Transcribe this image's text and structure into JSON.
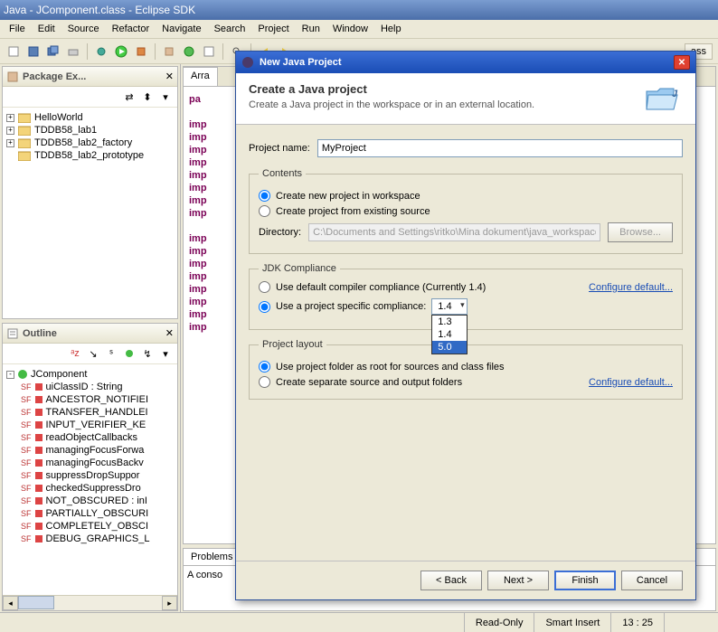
{
  "window": {
    "title": "Java - JComponent.class - Eclipse SDK"
  },
  "menu": [
    "File",
    "Edit",
    "Source",
    "Refactor",
    "Navigate",
    "Search",
    "Project",
    "Run",
    "Window",
    "Help"
  ],
  "package_explorer": {
    "title": "Package Ex...",
    "items": [
      {
        "label": "HelloWorld",
        "expandable": true
      },
      {
        "label": "TDDB58_lab1",
        "expandable": true
      },
      {
        "label": "TDDB58_lab2_factory",
        "expandable": true
      },
      {
        "label": "TDDB58_lab2_prototype",
        "expandable": false
      }
    ]
  },
  "outline": {
    "title": "Outline",
    "root": "JComponent",
    "items": [
      "uiClassID : String",
      "ANCESTOR_NOTIFIEI",
      "TRANSFER_HANDLEI",
      "INPUT_VERIFIER_KE",
      "readObjectCallbacks",
      "managingFocusForwa",
      "managingFocusBackv",
      "suppressDropSuppor",
      "checkedSuppressDro",
      "NOT_OBSCURED : inI",
      "PARTIALLY_OBSCURI",
      "COMPLETELY_OBSCI",
      "DEBUG_GRAPHICS_L"
    ]
  },
  "editor": {
    "tab": "Arra",
    "lines": [
      "pa",
      "",
      "imp",
      "imp",
      "imp",
      "imp",
      "imp",
      "imp",
      "imp",
      "imp",
      "",
      "imp",
      "imp",
      "imp",
      "imp",
      "imp",
      "imp",
      "imp",
      "imp"
    ]
  },
  "problems": {
    "tab": "Problems",
    "content": "A conso"
  },
  "dialog": {
    "title": "New Java Project",
    "banner_title": "Create a Java project",
    "banner_desc": "Create a Java project in the workspace or in an external location.",
    "project_name_label": "Project name:",
    "project_name_value": "MyProject",
    "contents": {
      "legend": "Contents",
      "opt1": "Create new project in workspace",
      "opt2": "Create project from existing source",
      "dir_label": "Directory:",
      "dir_value": "C:\\Documents and Settings\\ritko\\Mina dokument\\java_workspace",
      "browse": "Browse..."
    },
    "jdk": {
      "legend": "JDK Compliance",
      "opt1": "Use default compiler compliance (Currently 1.4)",
      "opt2": "Use a project specific compliance:",
      "selected": "1.4",
      "options": [
        "1.3",
        "1.4",
        "5.0"
      ],
      "configure": "Configure default..."
    },
    "layout": {
      "legend": "Project layout",
      "opt1": "Use project folder as root for sources and class files",
      "opt2": "Create separate source and output folders",
      "configure": "Configure default..."
    },
    "buttons": {
      "back": "< Back",
      "next": "Next >",
      "finish": "Finish",
      "cancel": "Cancel"
    }
  },
  "status": {
    "readonly": "Read-Only",
    "insert": "Smart Insert",
    "pos": "13 : 25"
  },
  "perspective": "ass"
}
